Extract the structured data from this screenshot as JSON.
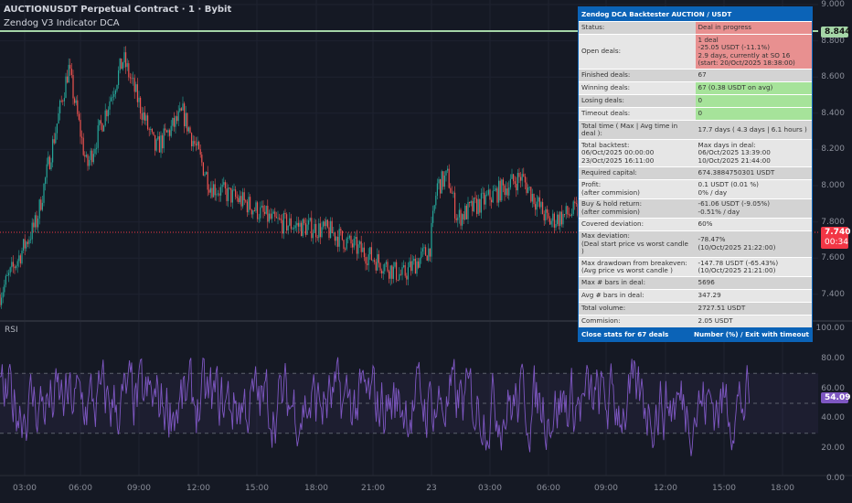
{
  "header": {
    "title": "AUCTIONUSDT Perpetual Contract · 1 · Bybit",
    "indicator": "Zendog V3 Indicator DCA"
  },
  "rsi_label": "RSI",
  "price_axis": [
    "9.000",
    "8.800",
    "8.600",
    "8.400",
    "8.200",
    "8.000",
    "7.800",
    "7.600",
    "7.400"
  ],
  "rsi_axis": [
    "100.00",
    "80.00",
    "60.00",
    "40.00",
    "20.00",
    "0.00"
  ],
  "time_axis": [
    "03:00",
    "06:00",
    "09:00",
    "12:00",
    "15:00",
    "18:00",
    "21:00",
    "23",
    "03:00",
    "06:00",
    "09:00",
    "12:00",
    "15:00",
    "18:00"
  ],
  "badges": {
    "green_line": "8.844",
    "price": "7.740",
    "countdown": "00:34",
    "rsi": "54.09"
  },
  "colors": {
    "up": "#26a69a",
    "down": "#ef5350",
    "rsi": "#7e57c2",
    "green_line": "#a5d6a7",
    "table_head": "#0b63b7",
    "red_cell": "#e89090",
    "green_cell": "#a6e39a"
  },
  "table": {
    "title": "Zendog DCA Backtester AUCTION / USDT",
    "rows": [
      [
        "Status:",
        "Deal in progress",
        "red"
      ],
      [
        "Open deals:",
        "1 deal\n-25.05 USDT (-11.1%)\n2.9 days, currently at SO 16\n(start: 20/Oct/2025 18:38:00)",
        "red"
      ],
      [
        "Finished deals:",
        "67",
        ""
      ],
      [
        "Winning deals:",
        "67 (0.38 USDT on avg)",
        "green"
      ],
      [
        "Losing deals:",
        "0",
        "green"
      ],
      [
        "Timeout deals:",
        "0",
        "green"
      ],
      [
        "Total time  ( Max  |  Avg time in deal ):",
        "17.7 days    ( 4.3 days  |  6.1 hours )",
        ""
      ],
      [
        "Total backtest:\n06/Oct/2025 00:00:00\n23/Oct/2025 16:11:00",
        "Max days in deal:\n06/Oct/2025 13:39:00\n10/Oct/2025 21:44:00",
        ""
      ],
      [
        "Required capital:",
        "674.3884750301 USDT",
        ""
      ],
      [
        "Profit:\n(after commision)",
        "0.1 USDT (0.01 %)\n0% / day",
        ""
      ],
      [
        "Buy & hold return:\n(after commision)",
        "-61.06 USDT (-9.05%)\n-0.51% / day",
        ""
      ],
      [
        "Covered deviation:",
        "60%",
        ""
      ],
      [
        "Max deviation:\n(Deal start price vs worst candle )",
        "-78.47%\n(10/Oct/2025 21:22:00)",
        ""
      ],
      [
        "Max drawdown from breakeven:\n(Avg price vs worst candle )",
        "-147.78 USDT (-65.43%)\n(10/Oct/2025 21:21:00)",
        ""
      ],
      [
        "Max # bars in deal:",
        "5696",
        ""
      ],
      [
        "Avg # bars in deal:",
        "347.29",
        ""
      ],
      [
        "Total volume:",
        "2727.51 USDT",
        ""
      ],
      [
        "Commision:",
        "2.05 USDT",
        ""
      ]
    ],
    "footer_left": "Close stats for 67 deals",
    "footer_right": "Number (%) / Exit with timeout"
  }
}
